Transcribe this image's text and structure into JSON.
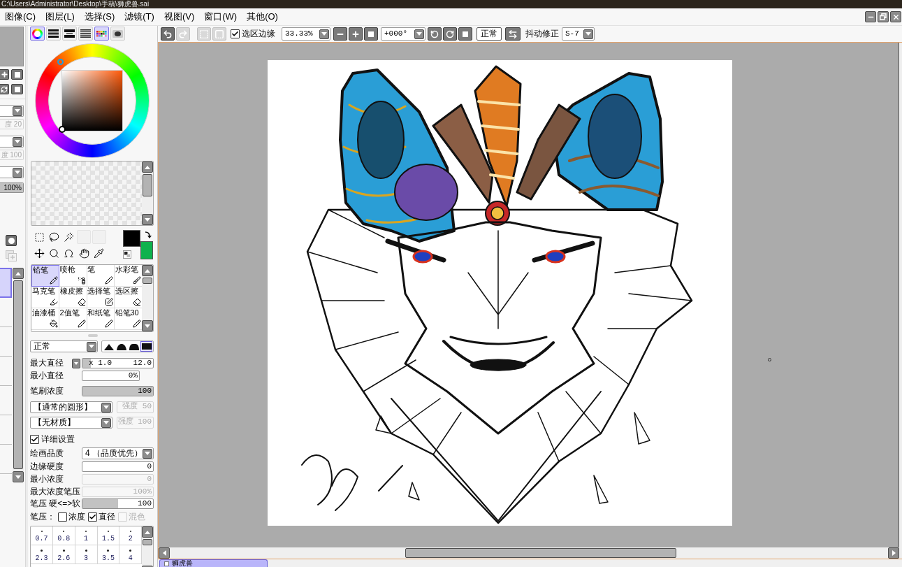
{
  "window": {
    "title": "C:\\Users\\Administrator\\Desktop\\手稿\\狮虎兽.sai"
  },
  "menu": [
    {
      "label": "图像(C)"
    },
    {
      "label": "图层(L)"
    },
    {
      "label": "选择(S)"
    },
    {
      "label": "滤镜(T)"
    },
    {
      "label": "视图(V)"
    },
    {
      "label": "窗口(W)"
    },
    {
      "label": "其他(O)"
    }
  ],
  "navigator": {
    "fields": [
      {
        "kind": "dropdown"
      },
      {
        "kind": "field",
        "value": "度 20",
        "disabled": true
      },
      {
        "kind": "dropdown"
      },
      {
        "kind": "field",
        "value": "度 100",
        "disabled": true
      },
      {
        "kind": "dropdown"
      },
      {
        "kind": "slider",
        "value": "100%",
        "level": 1
      }
    ]
  },
  "layers": [
    {
      "selected": true
    },
    {
      "selected": false
    },
    {
      "selected": false
    },
    {
      "selected": false
    },
    {
      "selected": false
    },
    {
      "selected": false
    },
    {
      "selected": false
    }
  ],
  "color_panel": {
    "modes": [
      {
        "kind": "wheel",
        "on": true
      },
      {
        "kind": "rgb-sliders",
        "on": false
      },
      {
        "kind": "hsv-sliders",
        "on": false
      },
      {
        "kind": "mixer",
        "on": false
      },
      {
        "kind": "swatches",
        "on": true
      },
      {
        "kind": "scratchpad",
        "on": false
      }
    ]
  },
  "colors": [
    {
      "kind": "primary",
      "color": "#000000"
    },
    {
      "kind": "secondary",
      "color": "#0fb24d"
    }
  ],
  "tools": [
    {
      "kind": "rect-select"
    },
    {
      "kind": "lasso"
    },
    {
      "kind": "magic-wand"
    },
    {
      "kind": "empty"
    },
    {
      "kind": "empty"
    },
    {
      "kind": "move"
    },
    {
      "kind": "zoom"
    },
    {
      "kind": "rotate"
    },
    {
      "kind": "hand"
    },
    {
      "kind": "eyedropper"
    }
  ],
  "brushes": [
    {
      "name": "铅笔",
      "kind": "pencil",
      "selected": true
    },
    {
      "name": "喷枪",
      "kind": "airbrush",
      "selected": false
    },
    {
      "name": "笔",
      "kind": "pen",
      "selected": false
    },
    {
      "name": "水彩笔",
      "kind": "watercolor",
      "selected": false
    },
    {
      "name": "马克笔",
      "kind": "marker",
      "selected": false
    },
    {
      "name": "橡皮擦",
      "kind": "eraser",
      "selected": false
    },
    {
      "name": "选择笔",
      "kind": "select-pen",
      "selected": false
    },
    {
      "name": "选区擦",
      "kind": "select-eraser",
      "selected": false
    },
    {
      "name": "油漆桶",
      "kind": "bucket",
      "selected": false
    },
    {
      "name": "2值笔",
      "kind": "binary-pen",
      "selected": false
    },
    {
      "name": "和纸笔",
      "kind": "washi-pen",
      "selected": false
    },
    {
      "name": "铅笔30",
      "kind": "pencil",
      "selected": false
    }
  ],
  "brush_settings": {
    "blend_mode": "正常",
    "tip_shapes": [
      {
        "kind": "peak",
        "selected": false
      },
      {
        "kind": "dome",
        "selected": false
      },
      {
        "kind": "flat",
        "selected": false
      },
      {
        "kind": "square",
        "selected": true
      }
    ],
    "max_size": {
      "label": "最大直径",
      "multiplier": "x 1.0",
      "value": "12.0",
      "level": 0.12
    },
    "min_size": {
      "label": "最小直径",
      "value": "0%"
    },
    "density": {
      "label": "笔刷浓度",
      "value": "100",
      "level": 1
    },
    "shape": {
      "value": "【通常的圆形】",
      "strength": "强度 50",
      "strength_disabled": true
    },
    "texture": {
      "value": "【无材质】",
      "strength": "强度 100",
      "strength_disabled": true
    },
    "advanced": {
      "label": "详细设置",
      "checked": true
    },
    "quality": {
      "label": "绘画品质",
      "value": "4 （品质优先）"
    },
    "fields": [
      {
        "label": "边缘硬度",
        "value": "0",
        "disabled": false
      },
      {
        "label": "最小浓度",
        "value": "0",
        "disabled": true
      },
      {
        "label": "最大浓度笔压",
        "value": "100%",
        "disabled": true
      },
      {
        "label": "笔压 硬<=>软",
        "value": "100",
        "level": 0.5,
        "disabled": false
      }
    ],
    "pressure": {
      "label": "笔压：",
      "options": [
        {
          "label": "浓度",
          "checked": false,
          "disabled": false
        },
        {
          "label": "直径",
          "checked": true,
          "disabled": false
        },
        {
          "label": "混色",
          "checked": false,
          "disabled": true
        }
      ]
    },
    "sizes": [
      {
        "label": "0.7"
      },
      {
        "label": "0.8"
      },
      {
        "label": "1"
      },
      {
        "label": "1.5"
      },
      {
        "label": "2"
      },
      {
        "label": "2.3"
      },
      {
        "label": "2.6"
      },
      {
        "label": "3"
      },
      {
        "label": "3.5"
      },
      {
        "label": "4"
      }
    ]
  },
  "canvas_toolbar": {
    "edit_buttons": [
      {
        "kind": "undo",
        "disabled": false
      },
      {
        "kind": "redo",
        "disabled": true
      },
      {
        "kind": "selection",
        "disabled": true
      },
      {
        "kind": "selection-clear",
        "disabled": true
      }
    ],
    "selection_edge": {
      "label": "选区边缘",
      "checked": true
    },
    "zoom": "33.33%",
    "rotation": "+000°",
    "view_mode": "正常",
    "stabilizer_label": "抖动修正",
    "stabilizer": "S-7"
  },
  "document_tabs": [
    {
      "label": "狮虎兽",
      "selected": true
    }
  ]
}
